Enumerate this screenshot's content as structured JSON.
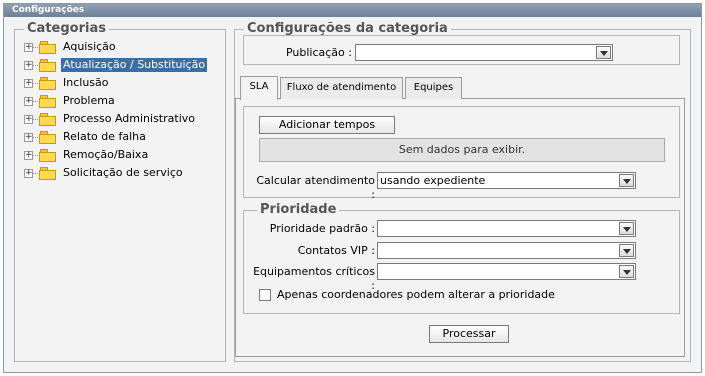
{
  "window": {
    "title": "Configurações"
  },
  "categories": {
    "legend": "Categorias",
    "items": [
      {
        "label": "Aquisição",
        "selected": false
      },
      {
        "label": "Atualização / Substituição",
        "selected": true
      },
      {
        "label": "Inclusão",
        "selected": false
      },
      {
        "label": "Problema",
        "selected": false
      },
      {
        "label": "Processo Administrativo",
        "selected": false
      },
      {
        "label": "Relato de falha",
        "selected": false
      },
      {
        "label": "Remoção/Baixa",
        "selected": false
      },
      {
        "label": "Solicitação de serviço",
        "selected": false
      }
    ],
    "expander_glyph": "+"
  },
  "config": {
    "legend": "Configurações da categoria",
    "publicacao_label": "Publicação :",
    "publicacao_value": ""
  },
  "tabs": [
    {
      "label": "SLA",
      "active": true
    },
    {
      "label": "Fluxo de atendimento",
      "active": false
    },
    {
      "label": "Equipes",
      "active": false
    }
  ],
  "sla": {
    "add_button": "Adicionar tempos",
    "empty_message": "Sem dados para exibir.",
    "calcular_label": "Calcular atendimento :",
    "calcular_value": "usando expediente"
  },
  "prioridade": {
    "legend": "Prioridade",
    "padrao_label": "Prioridade padrão :",
    "padrao_value": "",
    "vip_label": "Contatos VIP :",
    "vip_value": "",
    "criticos_label": "Equipamentos críticos :",
    "criticos_value": "",
    "checkbox_label": "Apenas coordenadores podem alterar a prioridade",
    "checkbox_checked": false
  },
  "footer": {
    "processar_label": "Processar"
  },
  "colors": {
    "selection": "#3a6ea5",
    "titlebar": "#7b8da2"
  }
}
